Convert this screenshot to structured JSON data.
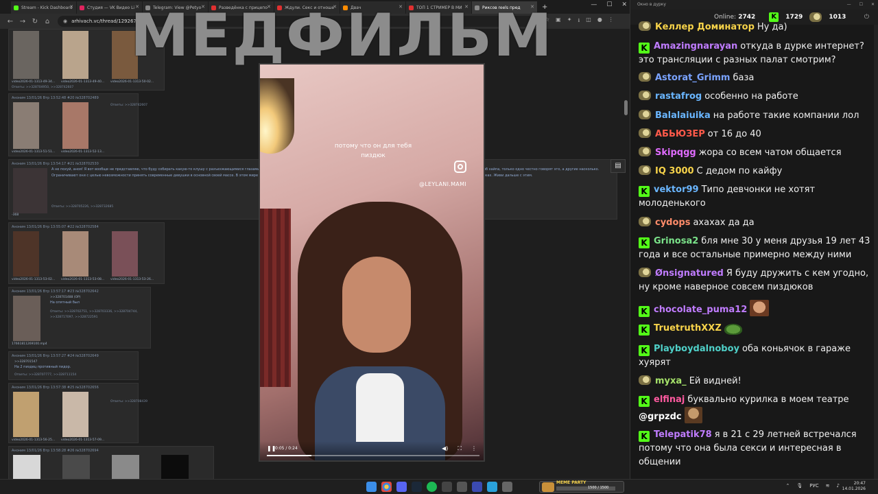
{
  "browser": {
    "tabs": [
      {
        "label": "Stream - Kick Dashboard",
        "color": "#53fc18"
      },
      {
        "label": "Студия — VK Видео Li",
        "color": "#e0245e"
      },
      {
        "label": "Telegram: View @Petyo",
        "color": "#888888"
      },
      {
        "label": "Разведёнка с прицепо",
        "color": "#e03030"
      },
      {
        "label": "Ждули. Секс и отноше",
        "color": "#e03030"
      },
      {
        "label": "Двач",
        "color": "#ff8c00"
      },
      {
        "label": "ТОП 1 СТРИМЕР В МИ",
        "color": "#e03030"
      },
      {
        "label": "Риксов reels пред",
        "color": "#888888"
      }
    ],
    "url": "arhivach.vc/thread/1292671/",
    "new_tab": "+",
    "window_controls": [
      "—",
      "☐",
      "✕"
    ]
  },
  "overlay_title": "МЕДФИЛЬМ",
  "thread": {
    "posts": [
      {
        "header": "Аноним 13/01/26 Втр 13:52:48 #20 №328702489",
        "files": [
          "video2026-01-1313-51-51...",
          "video2026-01-1313-52-13..."
        ],
        "answers": "Ответы: >>328742607"
      },
      {
        "header": "Аноним 13/01/26 Втр 13:54:17 #21 №328702530",
        "text": "А не похуй, аноя! Я вот вообще не представляю, что буду собирать какую-то клушу с разъезжающимися глазами. В большинстве мужчин в современном мире будут пытаться кинуть тебя с корыстной выгодой, придумывая лёгкий способ хайпа, только одно честно говорят это, а другие насколько. Ограничивают они с целью невозможности принять современные девушки в основной своей массе. В этом мире нет королев и принцесс. Из этой мерзости и неизбежности и вытекают все эти проблемы, которые они озвучивают в тиктоках. Живи дальше с этим.",
        "file": "-368",
        "answers": "Ответы: >>328705226, >>328732685"
      },
      {
        "header": "Аноним 13/01/26 Втр 13:55:07 #22 №328702584",
        "files": [
          "video2026-01-1313-53-02...",
          "video2026-01-1313-53-08...",
          "video2026-01-1313-53-26..."
        ]
      },
      {
        "header": "Аноним 13/01/26 Втр 13:57:17 #23 №328702642",
        "quote": ">>328701488 (OP)",
        "text": "На опятный был",
        "answers": "Ответы: >>328702751, >>328703336, >>328704744, >>328717097, >>328722591",
        "file": "17661811269100.mp4"
      },
      {
        "header": "Аноним 13/01/26 Втр 13:57:27 #24 №328702649",
        "quote": ">>328701547",
        "text": "На 2 пиздец противный пидор.",
        "answers": "Ответы: >>328707777, >>328711154"
      },
      {
        "header": "Аноним 13/01/26 Втр 13:57:38 #25 №328702656",
        "files": [
          "video2026-01-1313-56-25...",
          "video2026-01-1313-57-09..."
        ],
        "answers": "Ответы: >>328708439"
      },
      {
        "header": "Аноним 13/01/26 Втр 13:58:28 #26 №328702694"
      }
    ],
    "top_files": [
      "video2026-01-1313-49-34...",
      "video2026-01-1313-49-40...",
      "video2026-01-1313-50-02..."
    ],
    "top_answers": "Ответы: >>328704950, >>328742607"
  },
  "video": {
    "caption": "потому что он для тебя пиздюк",
    "handle": "@LEYLANI.MAMI",
    "time": "0:05 / 0:24",
    "progress": 0.21
  },
  "chat": {
    "window_title": "Окно в дурку",
    "online_label": "Online:",
    "online_count": "2742",
    "kick_count": "1729",
    "vk_count": "1013",
    "messages": [
      {
        "user": "Келлер Доминатор",
        "color": "#f7d34a",
        "badge": "vk",
        "text": "Ну да)"
      },
      {
        "user": "Amazingnarayan",
        "color": "#c07cff",
        "badge": "kick",
        "text": "откуда в дурке интернет? это трансляции с разных палат смотрим?"
      },
      {
        "user": "Astorat_Grimm",
        "color": "#7aa3ff",
        "badge": "vk",
        "text": "база"
      },
      {
        "user": "rastafrog",
        "color": "#6ab6ff",
        "badge": "vk",
        "text": "особенно на работе"
      },
      {
        "user": "Balalaiuika",
        "color": "#6ab6ff",
        "badge": "vk",
        "text": "на работе такие компании лол"
      },
      {
        "user": "АБЬЮЗЕР",
        "color": "#ff5a4a",
        "badge": "vk",
        "text": "от 16 до 40"
      },
      {
        "user": "Skipqgg",
        "color": "#e06cff",
        "badge": "vk",
        "text": "жора со всем чатом общается"
      },
      {
        "user": "IQ 3000",
        "color": "#f7d34a",
        "badge": "vk",
        "text": "С дедом по кайфу"
      },
      {
        "user": "vektor99",
        "color": "#6ab6ff",
        "badge": "kick",
        "text": "Типо девчонки не хотят молоденького"
      },
      {
        "user": "cydops",
        "color": "#ff8c6a",
        "badge": "vk",
        "text": "ахахах да да"
      },
      {
        "user": "Grinosa2",
        "color": "#7be38a",
        "badge": "kick",
        "text": "бля мне 30 у меня друзья 19 лет 43 года и все остальные примерно между ними"
      },
      {
        "user": "Ønsignatured",
        "color": "#c07cff",
        "badge": "vk",
        "text": "Я буду дружить с кем угодно, ну кроме наверное совсем пиздюков"
      },
      {
        "user": "chocolate_puma12",
        "color": "#c07cff",
        "badge": "kick",
        "text": ""
      },
      {
        "user": "TruetruthXXZ",
        "color": "#f7d34a",
        "badge": "kick",
        "text": ""
      },
      {
        "user": "Playboydalnoboy",
        "color": "#4fd0c8",
        "badge": "kick",
        "text": "оба коньячок в гараже хуярят"
      },
      {
        "user": "myxa_",
        "color": "#a6e36a",
        "badge": "vk",
        "text": "Ей видней!"
      },
      {
        "user": "elfinaj",
        "color": "#ff5aa0",
        "badge": "kick",
        "text": "буквально курилка в моем театре",
        "mention": "@grpzdc"
      },
      {
        "user": "Telepatik78",
        "color": "#c07cff",
        "badge": "kick",
        "text": "я в 21 с 29 летней встречался потому что она была секси и интересная в общении"
      }
    ]
  },
  "taskbar": {
    "widget_label": "MEME PARTY",
    "widget_count": "1500 / 1500",
    "lang": "РУС",
    "time": "20:47",
    "date": "14.01.2026"
  },
  "colors": {
    "kick_green": "#53fc18"
  }
}
